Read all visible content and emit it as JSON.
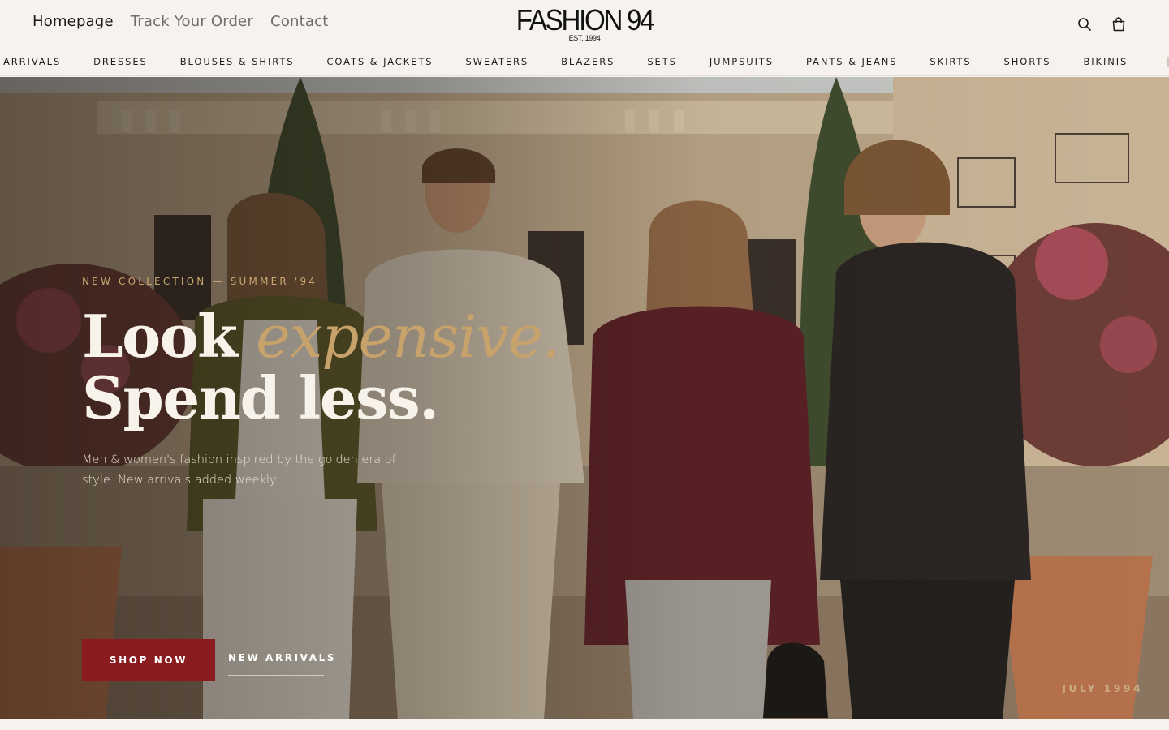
{
  "header": {
    "nav": [
      "Homepage",
      "Track Your Order",
      "Contact"
    ],
    "logo": {
      "main": "FASHION 94",
      "sub": "EST. 1994"
    },
    "icons": [
      "search-icon",
      "shopping-bag-icon"
    ]
  },
  "categories": [
    "ARRIVALS",
    "DRESSES",
    "BLOUSES & SHIRTS",
    "COATS & JACKETS",
    "SWEATERS",
    "BLAZERS",
    "SETS",
    "JUMPSUITS",
    "PANTS & JEANS",
    "SKIRTS",
    "SHORTS",
    "BIKINIS"
  ],
  "hero": {
    "eyebrow": "NEW COLLECTION — SUMMER '94",
    "headline_1": "Look",
    "headline_accent": "expensive.",
    "headline_2": "Spend less.",
    "subcopy": "Men & women's fashion inspired by the golden era of style. New arrivals added weekly.",
    "cta_primary": "SHOP NOW",
    "cta_secondary": "NEW ARRIVALS",
    "stamp": "JULY 1994"
  },
  "colors": {
    "accent_red": "#8a1c1f",
    "accent_gold": "#c7a26a",
    "background": "#f6f3ef"
  }
}
